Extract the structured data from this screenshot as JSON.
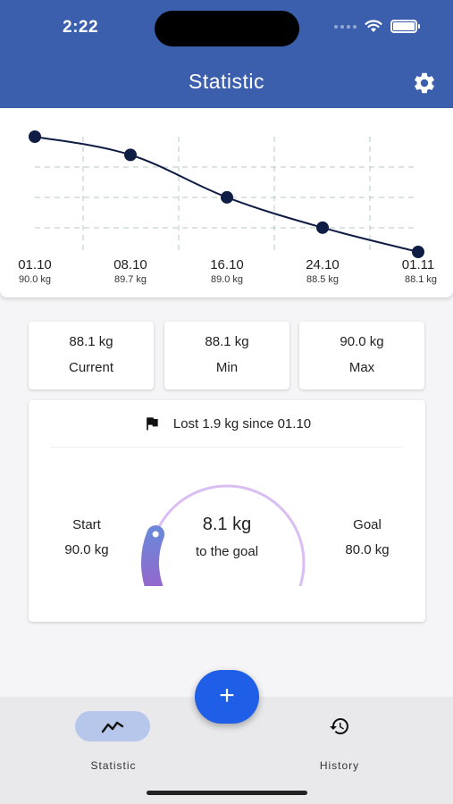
{
  "status_bar": {
    "time": "2:22"
  },
  "header": {
    "title": "Statistic",
    "settings_icon": "gear-icon",
    "background": "#3b5fad"
  },
  "chart_data": {
    "type": "line",
    "x": [
      "01.10",
      "08.10",
      "16.10",
      "24.10",
      "01.11"
    ],
    "weight_labels": [
      "90.0 kg",
      "89.7 kg",
      "89.0 kg",
      "88.5 kg",
      "88.1 kg"
    ],
    "values": [
      90.0,
      89.7,
      89.0,
      88.5,
      88.1
    ],
    "ylim": [
      88.1,
      90.0
    ],
    "grid": true,
    "line_color": "#0f1d45",
    "title": "",
    "xlabel": "",
    "ylabel": ""
  },
  "stats": [
    {
      "value": "88.1 kg",
      "label": "Current"
    },
    {
      "value": "88.1 kg",
      "label": "Min"
    },
    {
      "value": "90.0 kg",
      "label": "Max"
    }
  ],
  "goal": {
    "lost_text": "Lost 1.9 kg since 01.10",
    "flag_icon": "flag-icon",
    "start_label": "Start",
    "start_value": "90.0 kg",
    "goal_label": "Goal",
    "goal_value": "80.0 kg",
    "remaining": "8.1 kg",
    "remaining_sub": "to the goal",
    "progress_fraction": 0.19
  },
  "nav": {
    "items": [
      {
        "label": "Statistic",
        "icon": "trend-icon",
        "active": true
      },
      {
        "label": "History",
        "icon": "history-icon",
        "active": false
      }
    ],
    "fab_label": "+"
  }
}
